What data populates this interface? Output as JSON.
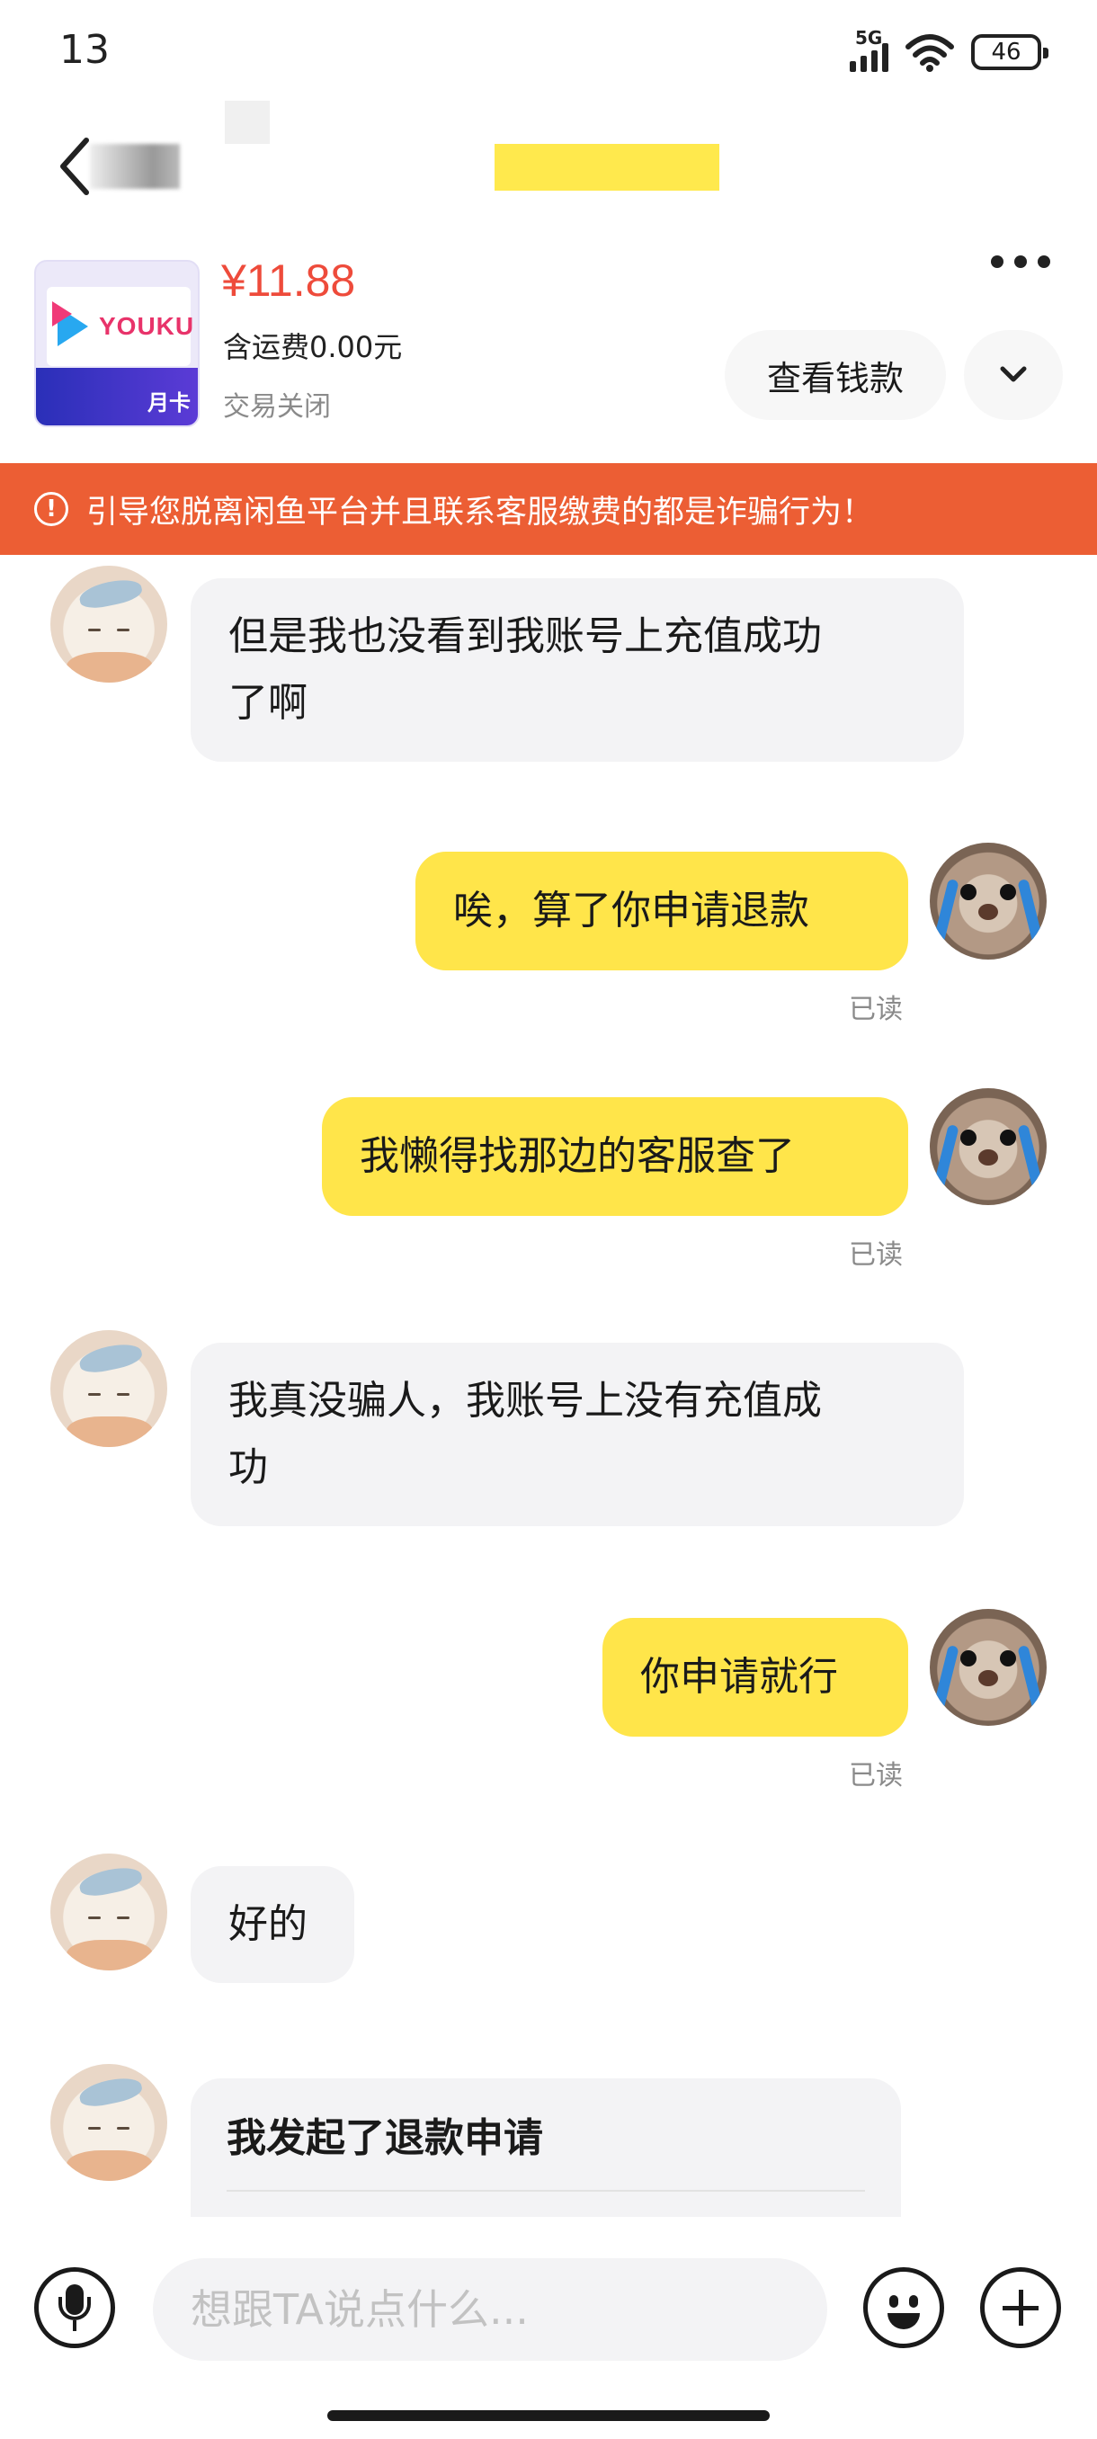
{
  "status_bar": {
    "time": "13",
    "network": "5G",
    "battery": "46"
  },
  "nav": {
    "back_icon": "chevron-left-icon",
    "more_icon": "more-horizontal-icon"
  },
  "product": {
    "thumbnail_brand": "YOUKU",
    "thumbnail_badge": "月卡",
    "price": "¥11.88",
    "shipping": "含运费0.00元",
    "trade_status": "交易关闭",
    "view_payment_label": "查看钱款",
    "expand_icon": "chevron-down-icon"
  },
  "warning": {
    "icon": "exclamation-circle-icon",
    "text": "引导您脱离闲鱼平台并且联系客服缴费的都是诈骗行为！"
  },
  "messages": [
    {
      "from": "other",
      "lines": [
        "但是我也没看到我账号上充值成功",
        "了啊"
      ]
    },
    {
      "from": "self",
      "text": "唉，算了你申请退款",
      "status": "已读"
    },
    {
      "from": "self",
      "text": "我懒得找那边的客服查了",
      "status": "已读"
    },
    {
      "from": "other",
      "lines": [
        "我真没骗人，我账号上没有充值成",
        "功"
      ]
    },
    {
      "from": "self",
      "text": "你申请就行",
      "status": "已读"
    },
    {
      "from": "other",
      "text": "好的"
    },
    {
      "from": "other",
      "card_title": "我发起了退款申请"
    }
  ],
  "input": {
    "placeholder": "想跟TA说点什么...",
    "mic_icon": "microphone-icon",
    "emoji_icon": "emoji-icon",
    "plus_icon": "plus-icon"
  },
  "colors": {
    "accent_yellow": "#ffe54a",
    "warning_orange": "#ec5e34",
    "price_red": "#ee4b3b"
  }
}
